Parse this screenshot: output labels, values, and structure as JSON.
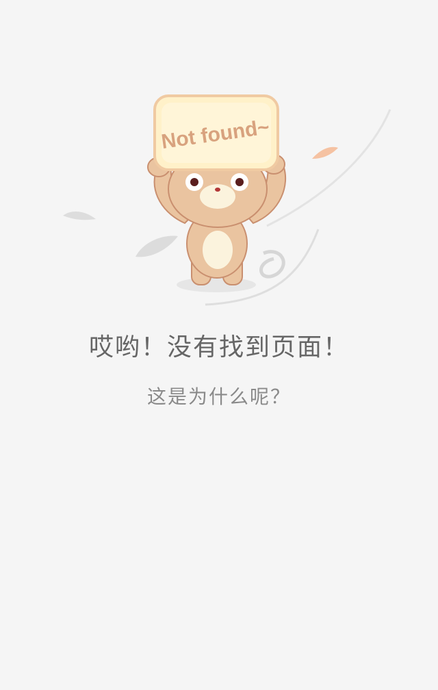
{
  "illustration": {
    "sign_text": "Not found~",
    "colors": {
      "bear_body": "#eac4a0",
      "bear_outline": "#c98f6f",
      "bear_belly": "#fbf3dd",
      "sign_fill": "#fff1c9",
      "sign_border": "#f0caa2",
      "sign_text": "#d8a27e",
      "leaf_gray": "#d9d9d9",
      "leaf_peach": "#f6c3a3"
    }
  },
  "message": {
    "title": "哎哟！没有找到页面！",
    "subtitle": "这是为什么呢？"
  }
}
